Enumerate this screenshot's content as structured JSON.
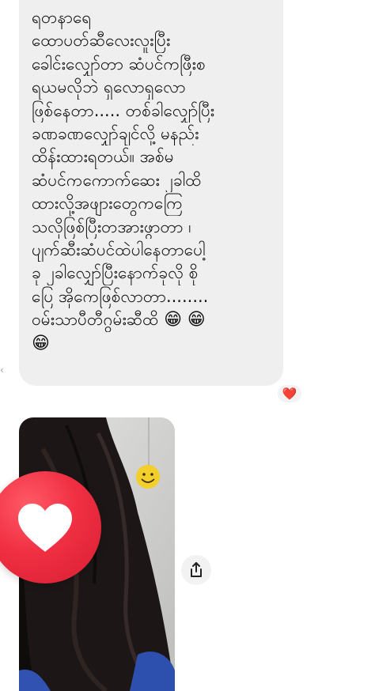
{
  "message": {
    "lines": [
      "ရတနာရေ",
      "ထောပတ်ဆီလေးလူးပြီး",
      "ခေါင်းလျှော်တာ ဆံပင်ကဖြီးစ",
      "ရယမလိုဘဲ ရှလောရှလော",
      "ဖြစ်နေတာ..... တစ်ခါလျှော်ပြီး",
      "ခဏခဏလျှော်ချင်လို့ မနည်း",
      "ထိန်းထားရတယ်။ အစ်မ",
      "ဆံပင်ကကောက်ဆေး ၂ခါထိ",
      "ထားလို့အဖျားတွေကကြေ",
      "သလိုဖြစ်ပြီးတအားဖွာတာ ၊",
      "ပျက်ဆီးဆံပင်ထဲပါနေတာပေါ့",
      "ခု ၂ခါလျှော်ပြီးနောက်ခုလို စို",
      "ပြေ အိုကေဖြစ်လာတာ........",
      "ဝမ်းသာပီတီဂွမ်းဆီထိ"
    ],
    "emoji_icon": "grinning-face-with-smiling-eyes-icon",
    "emoji": "😁"
  },
  "reactions": {
    "text_message_reaction": "❤️",
    "photo_reaction_icon": "heart-icon"
  },
  "photo": {
    "icon": "smiley-hanging-ornament",
    "share_icon": "share-icon"
  },
  "colors": {
    "bubble": "#efefef",
    "heart_red": "#f02f42",
    "chip": "#f2f2f2"
  }
}
